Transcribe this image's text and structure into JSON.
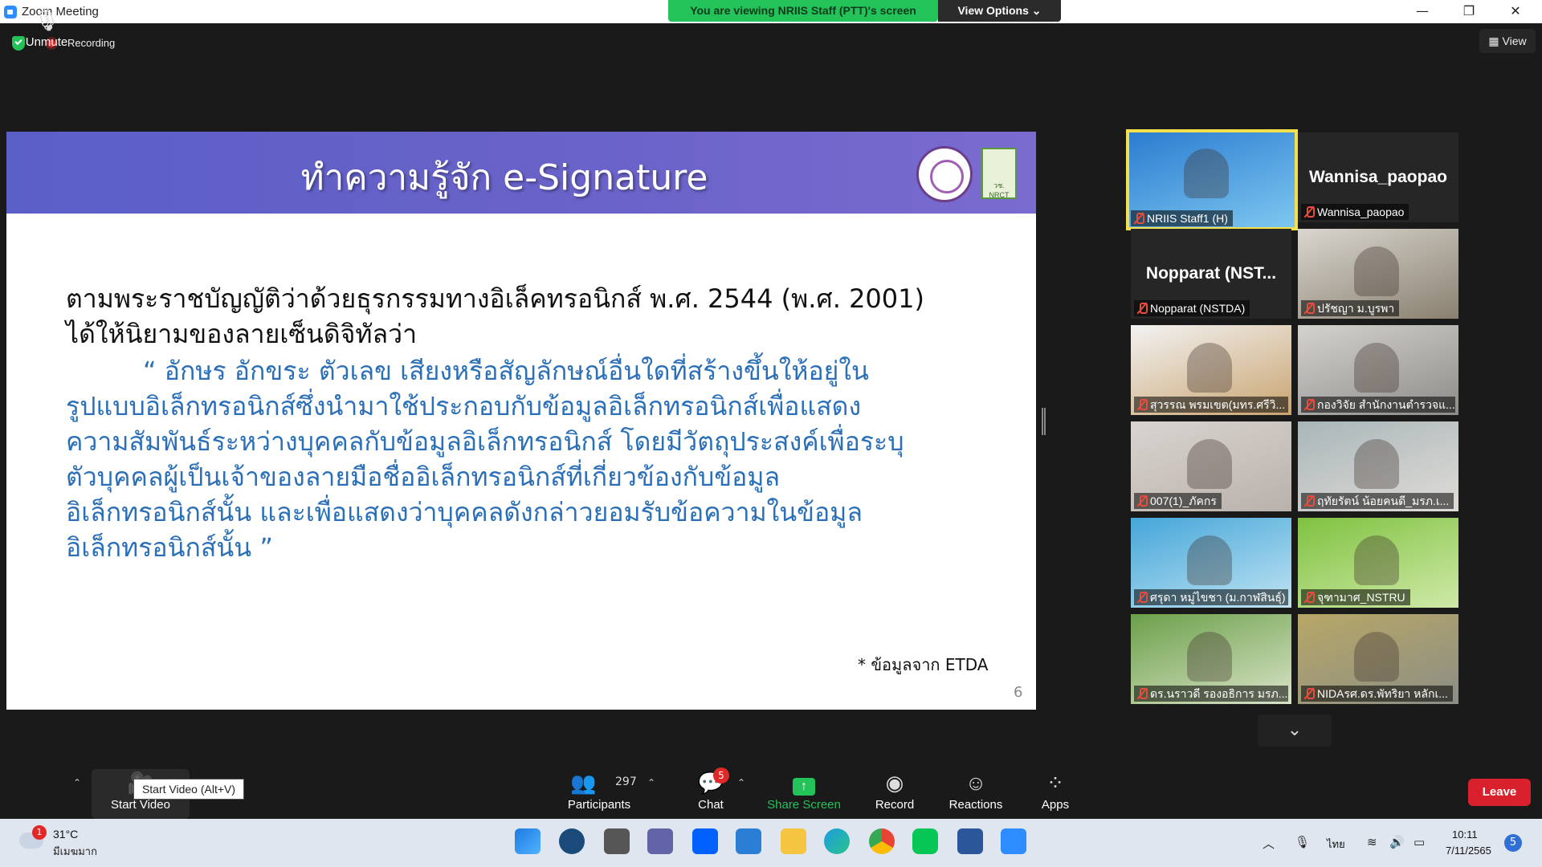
{
  "window": {
    "title": "Zoom Meeting",
    "viewing_banner": "You are viewing NRIIS Staff (PTT)'s screen",
    "view_options": "View Options ⌄",
    "minimize": "—",
    "restore": "❐",
    "close": "✕"
  },
  "topbar": {
    "recording_label": "Recording",
    "view_label": "View"
  },
  "slide": {
    "title": "ทำความรู้จัก e-Signature",
    "logo2_text": "วช. NRCT",
    "lines": [
      "ตามพระราชบัญญัติว่าด้วยธุรกรรมทางอิเล็คทรอนิกส์ พ.ศ. 2544 (พ.ศ. 2001)",
      " ได้ให้นิยามของลายเซ็นดิจิทัลว่า",
      "“ อักษร อักขระ ตัวเลข เสียงหรือสัญลักษณ์อื่นใดที่สร้างขึ้นให้อยู่ใน",
      "รูปแบบอิเล็กทรอนิกส์ซึ่งนำมาใช้ประกอบกับข้อมูลอิเล็กทรอนิกส์เพื่อแสดง",
      "ความสัมพันธ์ระหว่างบุคคลกับข้อมูลอิเล็กทรอนิกส์ โดยมีวัตถุประสงค์เพื่อระบุ",
      "ตัวบุคคลผู้เป็นเจ้าของลายมือชื่ออิเล็กทรอนิกส์ที่เกี่ยวข้องกับข้อมูล",
      "อิเล็กทรอนิกส์นั้น และเพื่อแสดงว่าบุคคลดังกล่าวยอมรับข้อความในข้อมูล",
      "อิเล็กทรอนิกส์นั้น ”"
    ],
    "footnote": "* ข้อมูลจาก ETDA",
    "page_number": "6"
  },
  "participants": [
    {
      "name": "NRIIS Staff1 (H)",
      "big_name": "",
      "video": true,
      "colors": [
        "#2a7bd0",
        "#7ec8f0"
      ]
    },
    {
      "name": "Wannisa_paopao",
      "big_name": "Wannisa_paopao",
      "video": false,
      "colors": [
        "#262626",
        "#262626"
      ]
    },
    {
      "name": "Nopparat (NSTDA)",
      "big_name": "Nopparat (NST...",
      "video": false,
      "colors": [
        "#262626",
        "#262626"
      ]
    },
    {
      "name": "ปรัชญา ม.บูรพา",
      "big_name": "",
      "video": true,
      "colors": [
        "#d8d6cf",
        "#8a8070"
      ]
    },
    {
      "name": "สุวรรณ พรมเขต(มทร.ศรีวิ...",
      "big_name": "",
      "video": true,
      "colors": [
        "#f2f2f2",
        "#c9a470"
      ]
    },
    {
      "name": "กองวิจัย สำนักงานตำรวจแ...",
      "big_name": "",
      "video": true,
      "colors": [
        "#d4d2cf",
        "#8d8c88"
      ]
    },
    {
      "name": "007(1)_ภัคกร",
      "big_name": "",
      "video": true,
      "colors": [
        "#d9d4d0",
        "#b9b1ab"
      ]
    },
    {
      "name": "ฤทัยรัตน์ น้อยคนดี_มรภ.เ...",
      "big_name": "",
      "video": true,
      "colors": [
        "#a9b6b8",
        "#e0dcd8"
      ]
    },
    {
      "name": "ศรุดา หมู่ไขชา (ม.กาฬสินธุ์)",
      "big_name": "",
      "video": true,
      "colors": [
        "#45a6d9",
        "#bfe3f2"
      ]
    },
    {
      "name": "จุฑามาศ_NSTRU",
      "big_name": "",
      "video": true,
      "colors": [
        "#7fc240",
        "#cfe9a8"
      ]
    },
    {
      "name": "ดร.นราวดี รองอธิการ มรภ....",
      "big_name": "",
      "video": true,
      "colors": [
        "#6ba04a",
        "#d9e3c7"
      ]
    },
    {
      "name": "NIDAรศ.ดร.พัทริยา หลักเ...",
      "big_name": "",
      "video": true,
      "colors": [
        "#b7a766",
        "#8c8e86"
      ]
    }
  ],
  "toolbar": {
    "unmute": "Unmute",
    "start_video": "Start Video",
    "tooltip": "Start Video (Alt+V)",
    "participants_count": "297",
    "participants": "Participants",
    "chat": "Chat",
    "chat_badge": "5",
    "share_screen": "Share Screen",
    "record": "Record",
    "reactions": "Reactions",
    "apps": "Apps",
    "leave": "Leave"
  },
  "taskbar": {
    "weather_badge": "1",
    "temperature": "31°C",
    "weather_desc": "มีเมฆมาก",
    "language": "ไทย",
    "time": "10:11",
    "date": "7/11/2565",
    "notifications": "5"
  },
  "colors": {
    "share_green": "#23c35a",
    "leave_red": "#d9202d",
    "slide_header": "#6b63c9",
    "quote_blue": "#2a6fb8"
  }
}
